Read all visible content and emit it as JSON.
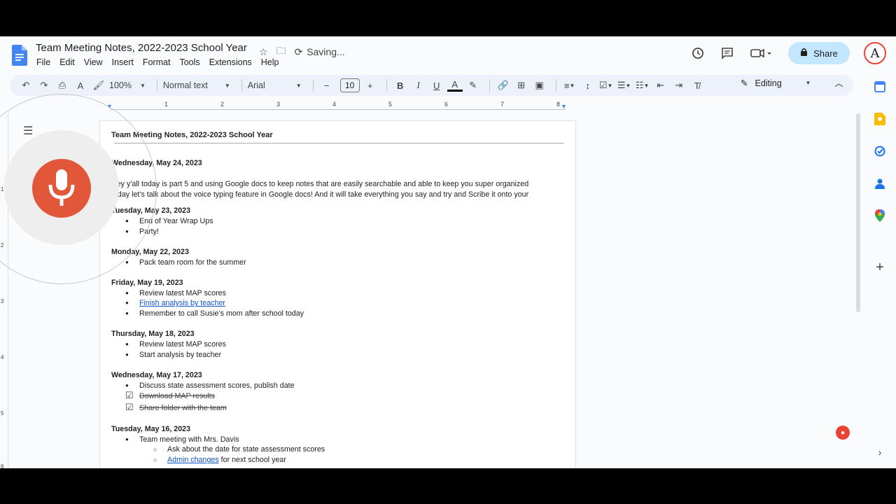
{
  "header": {
    "title": "Team Meeting Notes, 2022-2023 School Year",
    "saving": "Saving...",
    "share_label": "Share",
    "avatar_letter": "A",
    "menu": [
      "File",
      "Edit",
      "View",
      "Insert",
      "Format",
      "Tools",
      "Extensions",
      "Help"
    ]
  },
  "toolbar": {
    "zoom": "100%",
    "style": "Normal text",
    "font": "Arial",
    "font_size": "10",
    "mode": "Editing"
  },
  "ruler": [
    "1",
    "2",
    "3",
    "4",
    "5",
    "6",
    "7",
    "8"
  ],
  "vruler": [
    "1",
    "2",
    "3",
    "4",
    "5",
    "6"
  ],
  "doc": {
    "title": "Team Meeting Notes, 2022-2023 School Year",
    "entries": [
      {
        "date": "Wednesday, May 24, 2023"
      },
      {
        "date": "Tuesday, May 23, 2023",
        "items": [
          "End of Year Wrap Ups",
          "Party!"
        ]
      },
      {
        "date": "Monday, May 22, 2023",
        "items": [
          "Pack team room for the summer"
        ]
      },
      {
        "date": "Friday, May 19, 2023",
        "items": [
          "Review latest MAP scores",
          "Finish analysis by teacher",
          "Remember to call Susie’s mom after school today"
        ]
      },
      {
        "date": "Thursday, May 18, 2023",
        "items": [
          "Review latest MAP scores",
          "Start analysis by teacher"
        ]
      },
      {
        "date": "Wednesday, May 17, 2023",
        "items": [
          "Discuss state assessment scores, publish date"
        ],
        "checks": [
          "Download MAP results",
          "Share folder with the team"
        ]
      },
      {
        "date": "Tuesday, May 16, 2023",
        "items": [
          "Team meeting with Mrs. Davis"
        ],
        "subitems": [
          "Ask about the date for state assessment scores"
        ],
        "subitem_link": "Admin changes",
        "subitem_rest": " for next school year"
      }
    ],
    "paragraph_line1": "Hey y'all today is part 5 and using Google docs to keep notes that are easily searchable and able to keep you super organized",
    "paragraph_line2": "today let's talk about the voice typing feature in Google docs! And it will take everything you say and try and Scribe it onto your"
  },
  "colors": {
    "accent": "#c2e7ff",
    "mic": "#e2563a",
    "link": "#1155cc"
  }
}
